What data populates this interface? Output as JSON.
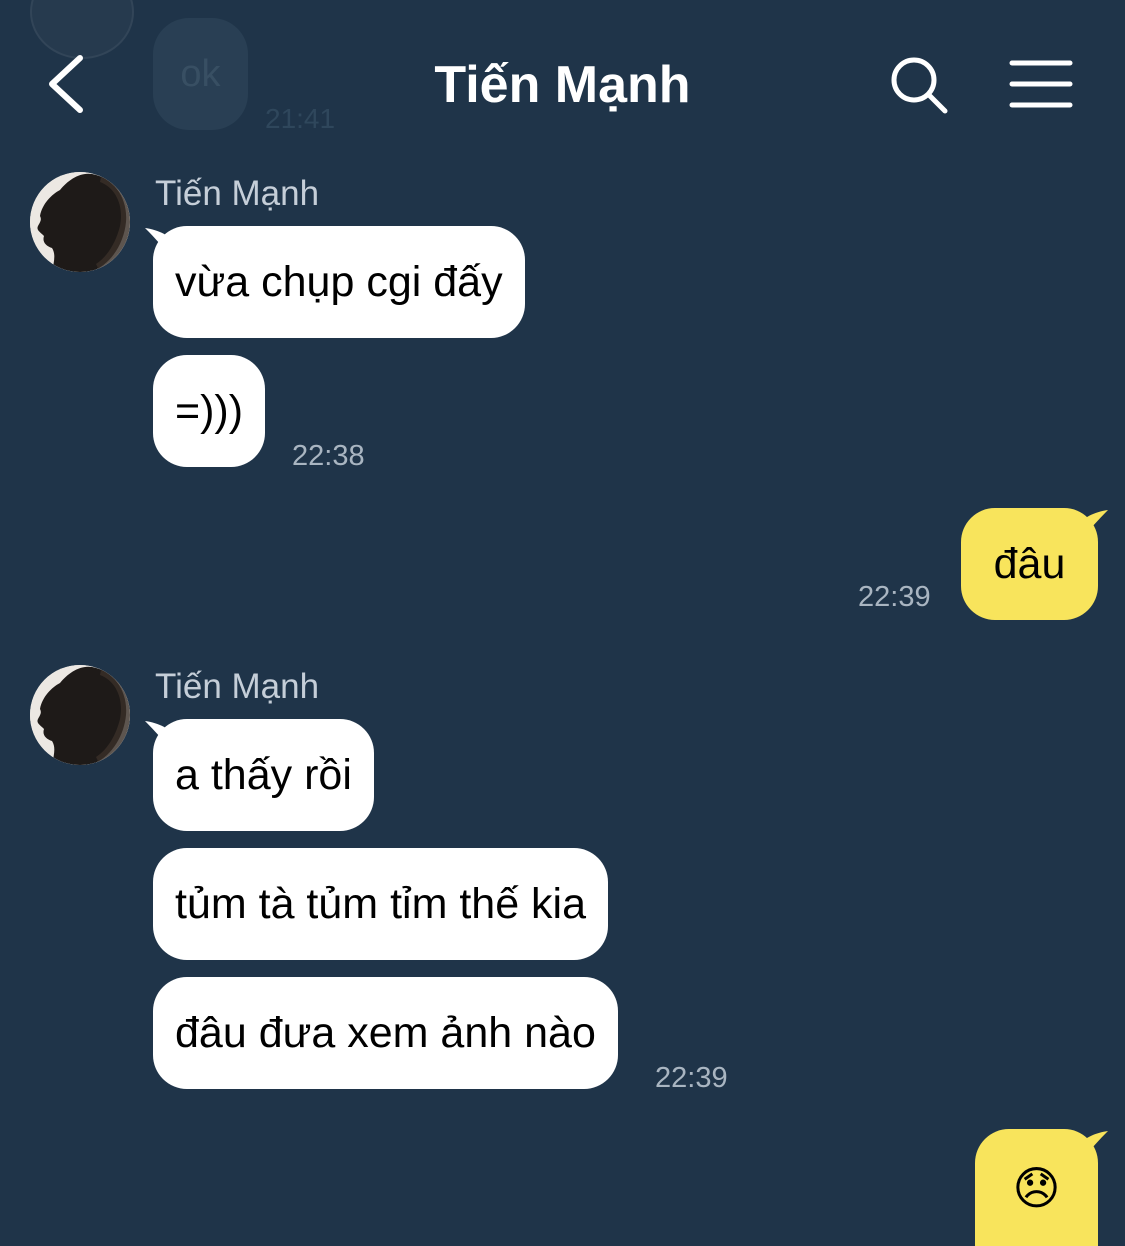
{
  "header": {
    "title": "Tiến Mạnh",
    "prev_message": {
      "text": "ok",
      "time": "21:41"
    },
    "back_icon": "chevron-left-icon",
    "search_icon": "search-icon",
    "menu_icon": "hamburger-menu-icon"
  },
  "groups": [
    {
      "sender": "Tiến Mạnh",
      "messages": [
        "vừa chụp cgi đấy",
        "=)))"
      ],
      "time": "22:38"
    },
    {
      "mine": true,
      "messages": [
        "đâu"
      ],
      "time": "22:39"
    },
    {
      "sender": "Tiến Mạnh",
      "messages": [
        "a thấy rồi",
        "tủm tà tủm tỉm thế kia",
        "đâu đưa xem ảnh nào"
      ],
      "time": "22:39"
    },
    {
      "mine": true,
      "messages": [
        "😞"
      ]
    }
  ],
  "colors": {
    "background": "#1f3449",
    "incoming_bubble": "#ffffff",
    "outgoing_bubble": "#f8e45c"
  }
}
